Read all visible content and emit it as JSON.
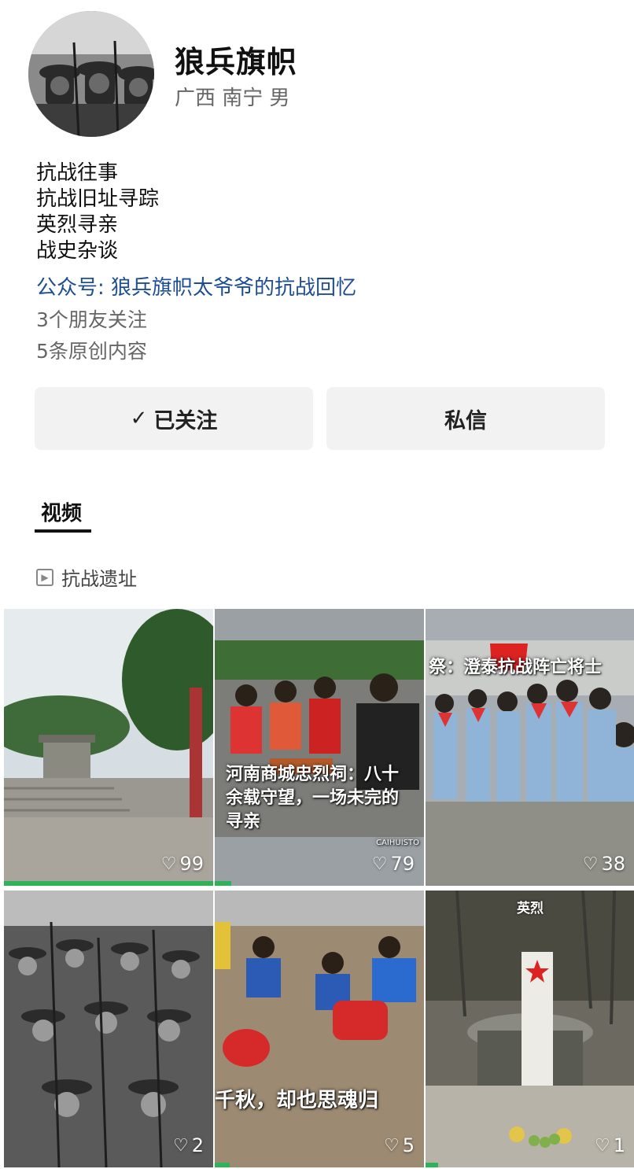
{
  "profile": {
    "name": "狼兵旗帜",
    "location": "广西 南宁 男",
    "bio": [
      "抗战往事",
      "抗战旧址寻踪",
      "英烈寻亲",
      "战史杂谈"
    ],
    "official_account": "公众号: 狼兵旗帜太爷爷的抗战回忆",
    "friends_following": "3个朋友关注",
    "original_content": "5条原创内容"
  },
  "actions": {
    "follow_check": "✓",
    "follow_label": "已关注",
    "message_label": "私信"
  },
  "tabs": {
    "videos": "视频"
  },
  "collection": {
    "label": "抗战遗址"
  },
  "videos": [
    {
      "likes": "99",
      "overlay": "",
      "progress": 1.0
    },
    {
      "likes": "79",
      "overlay": "河南商城忠烈祠：八十余载守望，一场未完的寻亲",
      "watermark": "CAIHUISTO",
      "progress": 0.08
    },
    {
      "likes": "38",
      "overlay": "祭：澄泰抗战阵亡将士",
      "progress": 0
    },
    {
      "likes": "2",
      "overlay": "",
      "progress": 0
    },
    {
      "likes": "5",
      "overlay": "千秋，却也思魂归",
      "progress": 0.07
    },
    {
      "likes": "1",
      "overlay": "",
      "tag": "英烈",
      "progress": 0.06
    }
  ],
  "colors": {
    "link": "#1d4e93",
    "progress": "#2fb25a"
  }
}
